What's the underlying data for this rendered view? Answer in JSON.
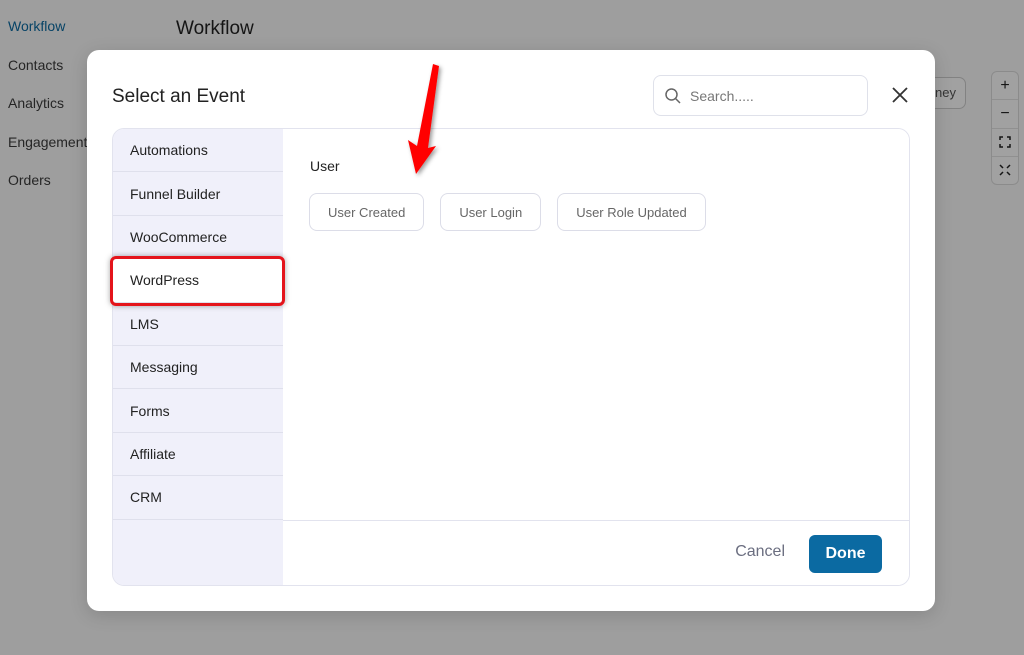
{
  "background": {
    "sidebar": [
      {
        "label": "Workflow",
        "active": true
      },
      {
        "label": "Contacts",
        "active": false
      },
      {
        "label": "Analytics",
        "active": false
      },
      {
        "label": "Engagement",
        "active": false
      },
      {
        "label": "Orders",
        "active": false
      }
    ],
    "page_title": "Workflow",
    "journey_button": "ney",
    "zoom_controls": [
      "+",
      "−",
      "fit",
      "expand"
    ]
  },
  "modal": {
    "title": "Select an Event",
    "search_placeholder": "Search.....",
    "categories": [
      {
        "label": "Automations"
      },
      {
        "label": "Funnel Builder"
      },
      {
        "label": "WooCommerce"
      },
      {
        "label": "WordPress",
        "selected": true
      },
      {
        "label": "LMS"
      },
      {
        "label": "Messaging"
      },
      {
        "label": "Forms"
      },
      {
        "label": "Affiliate"
      },
      {
        "label": "CRM"
      }
    ],
    "group_label": "User",
    "events": [
      "User Created",
      "User Login",
      "User Role Updated"
    ],
    "cancel_label": "Cancel",
    "done_label": "Done"
  },
  "colors": {
    "accent": "#0b6aa2",
    "annotation": "#e4141b"
  }
}
